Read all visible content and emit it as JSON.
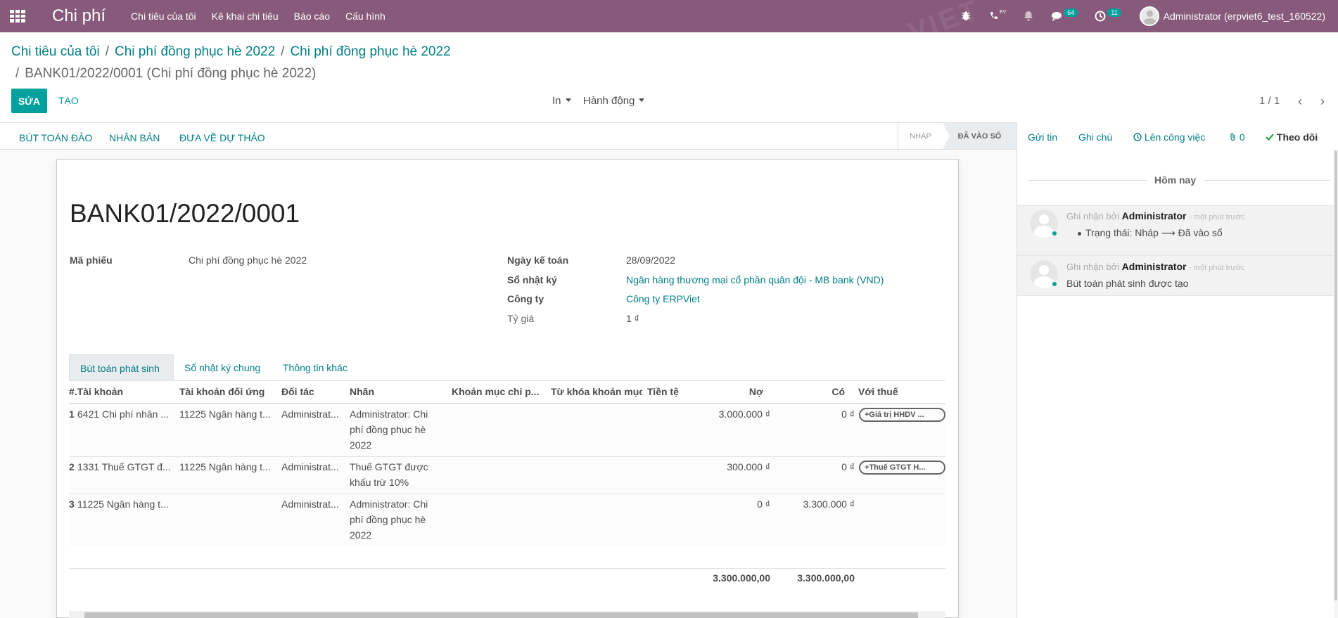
{
  "navbar": {
    "app_title": "Chi phí",
    "menu": [
      "Chi tiêu của tôi",
      "Kê khai chi tiêu",
      "Báo cáo",
      "Cấu hình"
    ],
    "messages_badge": "64",
    "activities_badge": "11",
    "user_name": "Administrator (erpviet6_test_160522)",
    "phone_label": "EV",
    "brand_color": "#875a7b",
    "icons": [
      "apps-icon",
      "bug-icon",
      "phone-icon",
      "bell-icon",
      "chat-icon",
      "clock-icon"
    ]
  },
  "breadcrumb": {
    "items": [
      "Chi tiêu của tôi",
      "Chi phí đồng phục hè 2022",
      "Chi phí đồng phục hè 2022"
    ],
    "current": "BANK01/2022/0001 (Chi phí đồng phục hè 2022)"
  },
  "control_panel": {
    "edit_label": "SỬA",
    "create_label": "TẠO",
    "print_label": "In",
    "action_label": "Hành động",
    "pager": "1 / 1"
  },
  "statusbar": {
    "buttons": [
      "BÚT TOÁN ĐẢO",
      "NHÂN BẢN",
      "ĐƯA VỀ DỰ THẢO"
    ],
    "stages": [
      "NHÁP",
      "ĐÃ VÀO SỔ"
    ],
    "current_stage": "ĐÃ VÀO SỔ"
  },
  "form": {
    "title": "BANK01/2022/0001",
    "ref_label": "Mã phiếu",
    "ref_value": "Chi phí đồng phục hè 2022",
    "date_label": "Ngày kế toán",
    "date_value": "28/09/2022",
    "journal_label": "Sổ nhật ký",
    "journal_value": "Ngân hàng thương mại cổ phần quân đội - MB bank (VND)",
    "company_label": "Công ty",
    "company_value": "Công ty ERPViet",
    "rate_label": "Tỷ giá",
    "rate_value": "1 ₫"
  },
  "tabs": [
    "Bút toán phát sinh",
    "Sổ nhật ký chung",
    "Thông tin khác"
  ],
  "table": {
    "headers": [
      "#.Tài khoản",
      "Tài khoản đối ứng",
      "Đối tác",
      "Nhãn",
      "Khoản mục chi p...",
      "Từ khóa khoản mục",
      "Tiền tệ",
      "Nợ",
      "Có",
      "Với thuế"
    ],
    "rows": [
      {
        "idx": "1",
        "account": "6421 Chi phí nhân ...",
        "counter": "11225 Ngân hàng t...",
        "partner": "Administrat...",
        "label": "Administrator: Chi phí đồng phục hè 2022",
        "debit": "3.000.000 ₫",
        "credit": "0 ₫",
        "tax": "+Giá trị HHDV ..."
      },
      {
        "idx": "2",
        "account": "1331 Thuế GTGT đ...",
        "counter": "11225 Ngân hàng t...",
        "partner": "Administrat...",
        "label": "Thuế GTGT được khấu trừ 10%",
        "debit": "300.000 ₫",
        "credit": "0 ₫",
        "tax": "+Thuế GTGT H..."
      },
      {
        "idx": "3",
        "account": "11225 Ngân hàng t...",
        "counter": "",
        "partner": "Administrat...",
        "label": "Administrator: Chi phí đồng phục hè 2022",
        "debit": "0 ₫",
        "credit": "3.300.000 ₫",
        "tax": ""
      }
    ],
    "total_debit": "3.300.000,00",
    "total_credit": "3.300.000,00"
  },
  "chatter": {
    "send_message": "Gửi tin",
    "log_note": "Ghi chú",
    "schedule_activity": "Lên công việc",
    "attachments": "0",
    "follow": "Theo dõi",
    "today": "Hôm nay",
    "messages": [
      {
        "prefix": "Ghi nhận bởi",
        "author": "Administrator",
        "time": "- một phút trước",
        "body": "Trạng thái: Nháp ⟶ Đã vào sổ",
        "bullet": true
      },
      {
        "prefix": "Ghi nhận bởi",
        "author": "Administrator",
        "time": "- một phút trước",
        "body": "Bút toán phát sinh được tạo",
        "bullet": false
      }
    ]
  }
}
